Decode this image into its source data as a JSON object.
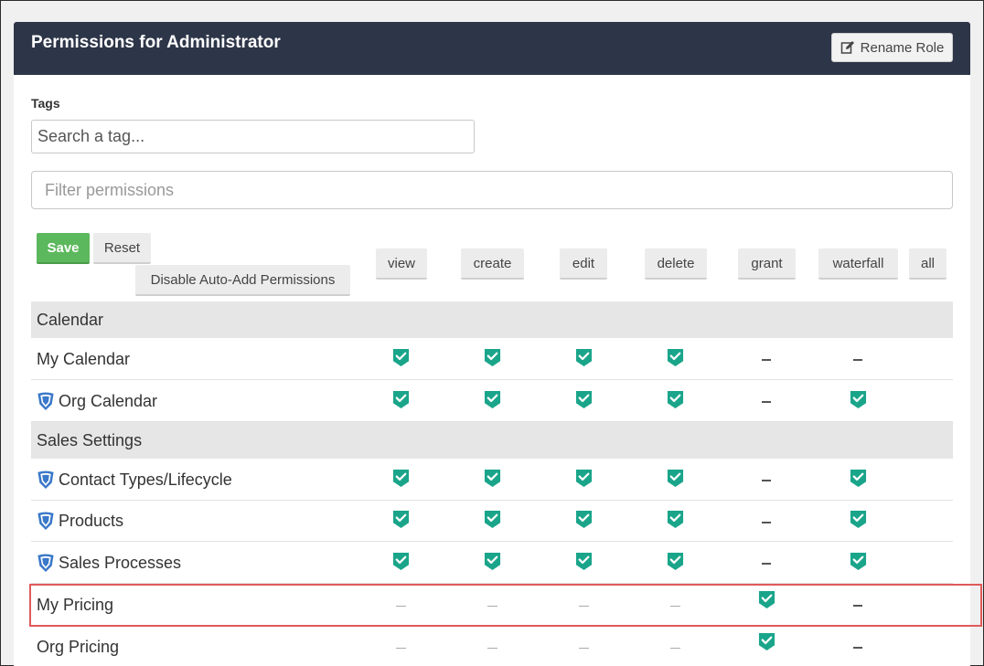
{
  "header": {
    "title": "Permissions for Administrator",
    "rename_label": "Rename Role"
  },
  "tags": {
    "label": "Tags",
    "placeholder": "Search a tag..."
  },
  "filter": {
    "placeholder": "Filter permissions"
  },
  "actions": {
    "save": "Save",
    "reset": "Reset",
    "auto_add": "Disable Auto-Add Permissions"
  },
  "columns": [
    "view",
    "create",
    "edit",
    "delete",
    "grant",
    "waterfall",
    "all"
  ],
  "groups": [
    {
      "name": "Calendar"
    },
    {
      "name": "Sales Settings"
    }
  ],
  "rows": [
    {
      "label": "My Calendar",
      "org_icon": false,
      "cells": [
        "check",
        "check",
        "check",
        "check",
        "dash",
        "dash"
      ]
    },
    {
      "label": "Org Calendar",
      "org_icon": true,
      "cells": [
        "check",
        "check",
        "check",
        "check",
        "dash",
        "check"
      ]
    },
    {
      "label": "Contact Types/Lifecycle",
      "org_icon": true,
      "cells": [
        "check",
        "check",
        "check",
        "check",
        "dash",
        "check"
      ]
    },
    {
      "label": "Products",
      "org_icon": true,
      "cells": [
        "check",
        "check",
        "check",
        "check",
        "dash",
        "check"
      ]
    },
    {
      "label": "Sales Processes",
      "org_icon": true,
      "cells": [
        "check",
        "check",
        "check",
        "check",
        "dash",
        "check"
      ]
    },
    {
      "label": "My Pricing",
      "org_icon": false,
      "cells": [
        "light",
        "light",
        "light",
        "light",
        "check",
        "dash"
      ]
    },
    {
      "label": "Org Pricing",
      "org_icon": false,
      "cells": [
        "light",
        "light",
        "light",
        "light",
        "check",
        "dash"
      ]
    }
  ],
  "colors": {
    "header_bg": "#2d3548",
    "check": "#1aa58a",
    "save": "#5cb85c",
    "highlight": "#e05a5a"
  }
}
